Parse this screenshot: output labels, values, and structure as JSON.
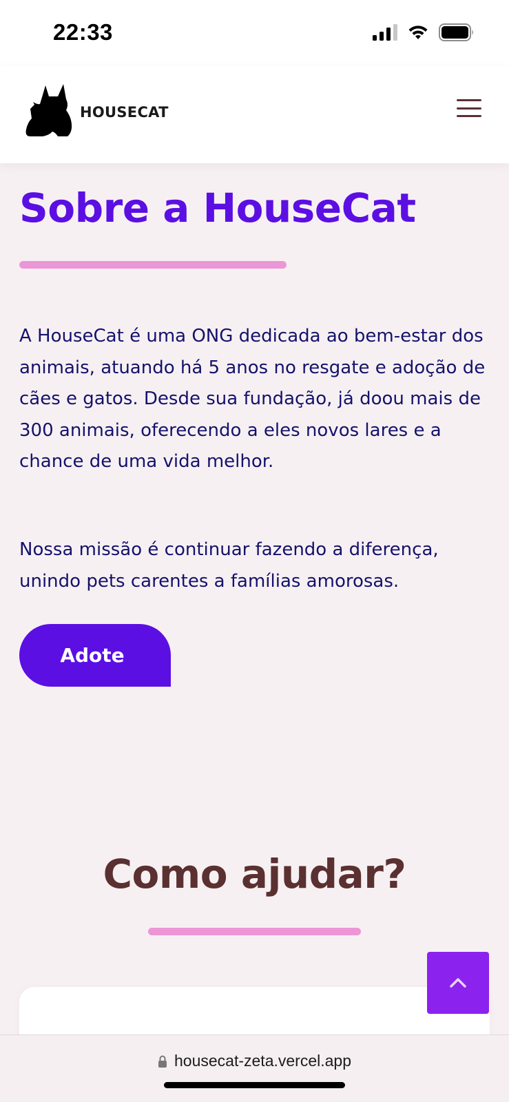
{
  "status_bar": {
    "time": "22:33",
    "icons": [
      "signal-icon",
      "wifi-icon",
      "battery-icon"
    ]
  },
  "header": {
    "logo_icon": "cat-icon",
    "logo_text": "HOUSECAT",
    "menu_icon": "hamburger-menu-icon"
  },
  "about": {
    "title": "Sobre a HouseCat",
    "paragraph1": "A HouseCat é uma ONG dedicada ao bem-estar dos animais, atuando há 5 anos no resgate e adoção de cães e gatos. Desde sua fundação, já doou mais de 300 animais, oferecendo a eles novos lares e a chance de uma vida melhor.",
    "paragraph2": "Nossa missão é continuar fazendo a diferença, unindo pets carentes a famílias amorosas.",
    "button_label": "Adote"
  },
  "help": {
    "title": "Como ajudar?"
  },
  "scroll_top": {
    "icon": "chevron-up-icon"
  },
  "browser": {
    "url": "housecat-zeta.vercel.app",
    "lock_icon": "lock-icon"
  },
  "colors": {
    "background": "#f7f0f3",
    "primary_purple": "#5b0fe3",
    "scroll_button_purple": "#8c22ee",
    "accent_pink": "#ec96d6",
    "text_navy": "#14126b",
    "brown_heading": "#5a3030"
  }
}
